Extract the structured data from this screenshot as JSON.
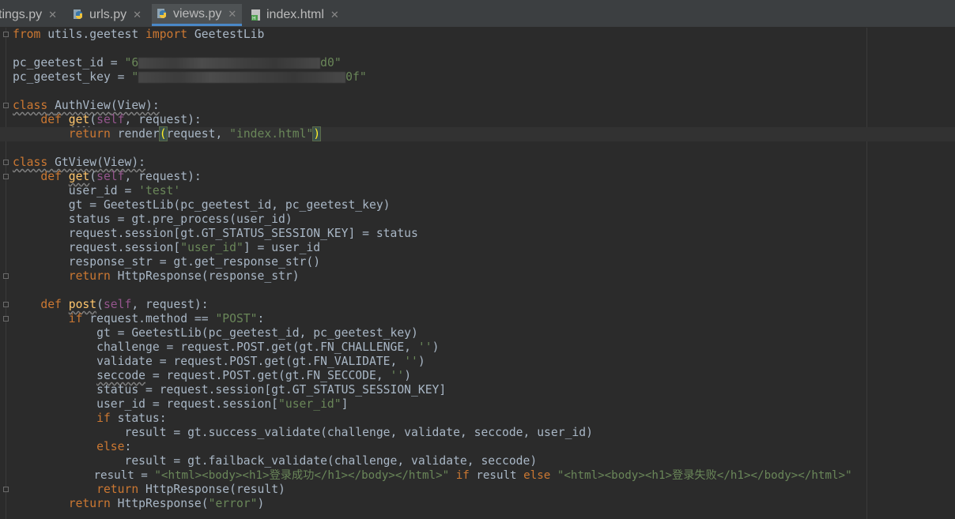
{
  "tabs": [
    {
      "label": "tings.py",
      "icon": "python-file-icon",
      "active": false
    },
    {
      "label": "urls.py",
      "icon": "python-file-icon",
      "active": false
    },
    {
      "label": "views.py",
      "icon": "python-file-icon",
      "active": true
    },
    {
      "label": "index.html",
      "icon": "html-file-icon",
      "active": false
    }
  ],
  "code": {
    "l1": {
      "kw1": "from",
      "mod": " utils.geetest ",
      "kw2": "import",
      "name": " GeetestLib"
    },
    "l3": {
      "lhs": "pc_geetest_id = ",
      "s1": "\"6",
      "s2": "d0\""
    },
    "l4": {
      "lhs": "pc_geetest_key = ",
      "s1": "\"",
      "s2": "0f\""
    },
    "l6": {
      "kw": "class",
      "sp": " ",
      "name": "AuthView",
      "rest": "(View):"
    },
    "l7": {
      "ind": "    ",
      "kw": "def",
      "sp": " ",
      "fn": "get",
      "p1": "(",
      "self": "self",
      "rest": ", request):"
    },
    "l8": {
      "ind": "        ",
      "kw": "return",
      "a": " render",
      "po": "(",
      "b": "request, ",
      "str": "\"index.html\"",
      "pc": ")"
    },
    "l10": {
      "kw": "class",
      "sp": " ",
      "name": "GtView",
      "rest": "(View):"
    },
    "l11": {
      "ind": "    ",
      "kw": "def",
      "sp": " ",
      "fn": "get",
      "p1": "(",
      "self": "self",
      "rest": ", request):"
    },
    "l12": {
      "a": "        user_id = ",
      "str": "'test'"
    },
    "l13": {
      "a": "        gt = GeetestLib(pc_geetest_id, pc_geetest_key)"
    },
    "l14": {
      "a": "        status = gt.pre_process(user_id)"
    },
    "l15": {
      "a": "        request.session[gt.GT_STATUS_SESSION_KEY] = status"
    },
    "l16": {
      "a": "        request.session[",
      "str": "\"user_id\"",
      "b": "] = user_id"
    },
    "l17": {
      "a": "        response_str = gt.get_response_str()"
    },
    "l18": {
      "ind": "        ",
      "kw": "return",
      "a": " HttpResponse(response_str)"
    },
    "l20": {
      "ind": "    ",
      "kw": "def",
      "sp": " ",
      "fn": "post",
      "p1": "(",
      "self": "self",
      "rest": ", request):"
    },
    "l21": {
      "ind": "        ",
      "kw": "if",
      "a": " request.method == ",
      "str": "\"POST\"",
      "b": ":"
    },
    "l22": {
      "a": "            gt = GeetestLib(pc_geetest_id, pc_geetest_key)"
    },
    "l23": {
      "a": "            challenge = request.POST.get(gt.FN_CHALLENGE, ",
      "str": "''",
      "b": ")"
    },
    "l24": {
      "a": "            validate = request.POST.get(gt.FN_VALIDATE, ",
      "str": "''",
      "b": ")"
    },
    "l25": {
      "ind": "            ",
      "w": "seccode",
      "a": " = request.POST.get(gt.FN_SECCODE, ",
      "str": "''",
      "b": ")"
    },
    "l26": {
      "a": "            status = request.session[gt.GT_STATUS_SESSION_KEY]"
    },
    "l27": {
      "a": "            user_id = request.session[",
      "str": "\"user_id\"",
      "b": "]"
    },
    "l28": {
      "ind": "            ",
      "kw": "if",
      "a": " status:"
    },
    "l29": {
      "a": "                result = gt.success_validate(challenge, validate, seccode, user_id)"
    },
    "l30": {
      "ind": "            ",
      "kw": "else",
      "a": ":"
    },
    "l31": {
      "a": "                result = gt.failback_validate(challenge, validate, seccode)"
    },
    "l32": {
      "a": "            result = ",
      "s1": "\"<html><body><h1>登录成功</h1></body></html>\"",
      "k1": " if ",
      "b": "result",
      "k2": " else ",
      "s2": "\"<html><body><h1>登录失败</h1></body></html>\""
    },
    "l33": {
      "ind": "            ",
      "kw": "return",
      "a": " HttpResponse(result)"
    },
    "l34": {
      "ind": "        ",
      "kw": "return",
      "a": " HttpResponse(",
      "str": "\"error\"",
      "b": ")"
    }
  },
  "colors": {
    "background": "#2b2b2b",
    "keyword": "#cc7832",
    "string": "#6a8759",
    "function": "#ffc66d",
    "self": "#94558d",
    "text": "#a9b7c6"
  }
}
